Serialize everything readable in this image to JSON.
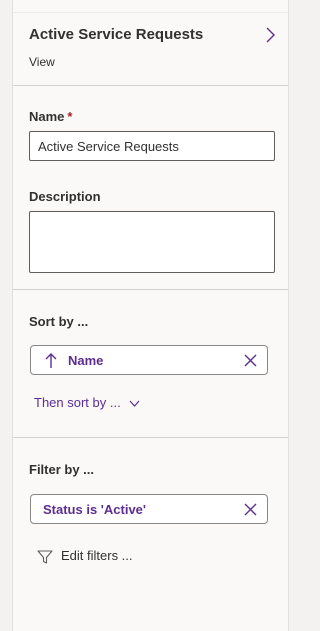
{
  "header": {
    "title": "Active Service Requests",
    "subtitle": "View"
  },
  "name_field": {
    "label": "Name",
    "required_mark": "*",
    "value": "Active Service Requests"
  },
  "description_field": {
    "label": "Description",
    "value": ""
  },
  "sort": {
    "label": "Sort by ...",
    "pill_label": "Name",
    "pill_icon": "arrow-up-icon",
    "then_sort_label": "Then sort by ..."
  },
  "filter": {
    "label": "Filter by ...",
    "pill_label": "Status is 'Active'",
    "edit_label": "Edit filters ..."
  },
  "colors": {
    "accent": "#5c2e91",
    "required": "#a4262c",
    "panel_bg": "#faf9f8",
    "page_bg": "#f3f2f1"
  }
}
